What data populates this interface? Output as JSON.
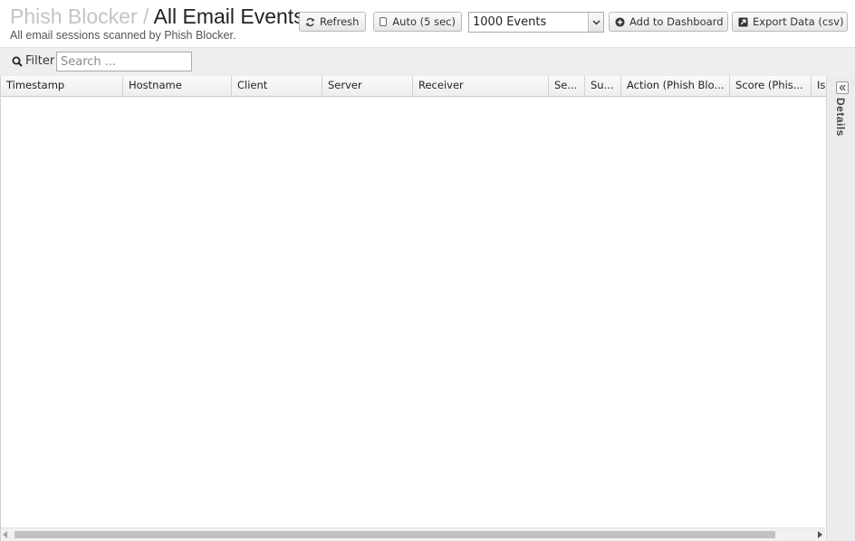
{
  "header": {
    "app_name": "Phish Blocker",
    "separator": "/",
    "page_title": "All Email Events",
    "subtitle": "All email sessions scanned by Phish Blocker."
  },
  "toolbar": {
    "refresh_label": "Refresh",
    "auto_label": "Auto (5 sec)",
    "auto_checked": false,
    "event_limit_selected": "1000 Events",
    "add_dashboard_label": "Add to Dashboard",
    "export_label": "Export Data (csv)"
  },
  "filter": {
    "label": "Filter",
    "placeholder": "Search ...",
    "value": ""
  },
  "grid": {
    "columns": [
      "Timestamp",
      "Hostname",
      "Client",
      "Server",
      "Receiver",
      "Se...",
      "Su...",
      "Action (Phish Blo...",
      "Score (Phis...",
      "Is"
    ],
    "rows": []
  },
  "details": {
    "label": "Details"
  },
  "icons": {
    "refresh": "refresh-icon",
    "checkbox": "checkbox-icon",
    "dropdown": "chevron-down-icon",
    "add": "plus-circle-icon",
    "export": "export-icon",
    "search": "search-icon",
    "collapse": "double-chevron-left-icon"
  }
}
